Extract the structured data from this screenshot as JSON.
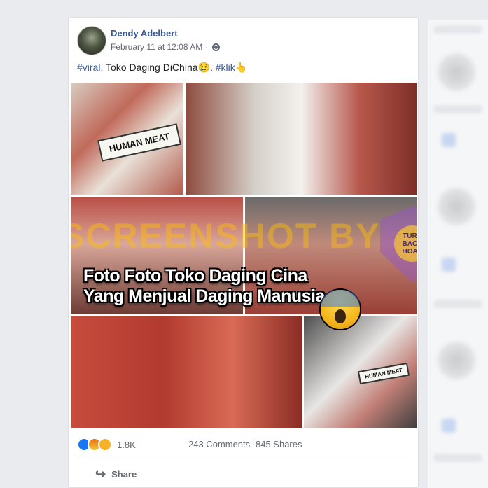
{
  "post": {
    "author": "Dendy Adelbert",
    "timestamp": "February 11 at 12:08 AM",
    "separator": "·",
    "privacy_icon": "globe-icon",
    "caption": {
      "tag1": "#viral",
      "text": ", Toko Daging DiChina",
      "emoji1": "😢",
      "dot": ". ",
      "tag2": "#klik",
      "emoji2": "👆"
    }
  },
  "media": {
    "headline_line1": "Foto Foto Toko Daging Cina",
    "headline_line2": "Yang Menjual Daging Manusia",
    "sticker1": "HUMAN MEAT",
    "sticker2": "HUMAN MEAT",
    "watermark": "SCREENSHOT BY",
    "badge_text": "TURN BACK HOAX"
  },
  "footer": {
    "reaction_icons": [
      "like-icon",
      "angry-icon",
      "wow-icon"
    ],
    "reaction_count": "1.8K",
    "comments": "243 Comments",
    "shares": "845 Shares",
    "share_label": "Share"
  },
  "colors": {
    "link": "#385898",
    "page_bg": "#e9ebee",
    "meta_text": "#616770"
  }
}
